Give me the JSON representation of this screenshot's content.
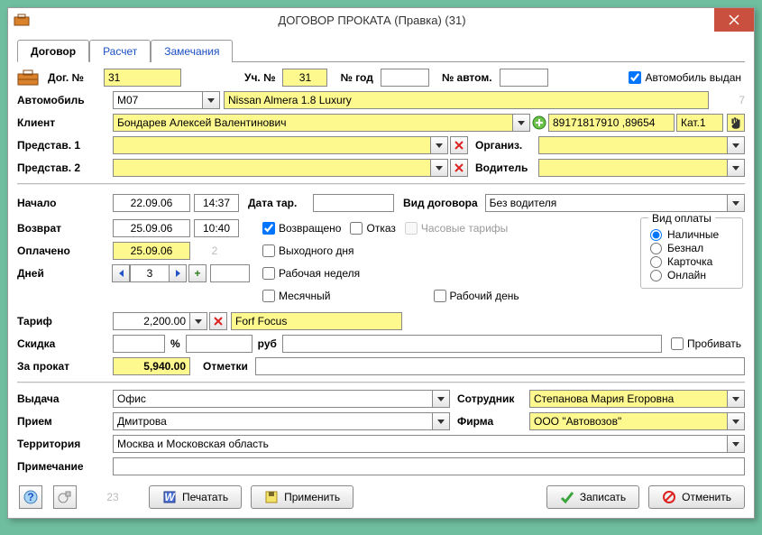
{
  "window": {
    "title": "ДОГОВОР ПРОКАТА (Правка)  (31)"
  },
  "tabs": {
    "contract": "Договор",
    "calc": "Расчет",
    "notes": "Замечания"
  },
  "hdr": {
    "dog_no_label": "Дог. №",
    "dog_no": "31",
    "uch_no_label": "Уч. №",
    "uch_no": "31",
    "year_label": "№ год",
    "year": "",
    "auto_no_label": "№ автом.",
    "auto_no": "",
    "car_given_label": "Автомобиль выдан"
  },
  "car": {
    "label": "Автомобиль",
    "code": "M07",
    "name": "Nissan Almera 1.8 Luxury",
    "extra": "7"
  },
  "client": {
    "label": "Клиент",
    "name": "Бондарев Алексей Валентинович",
    "phone": "89171817910 ,89654",
    "cat": "Кат.1"
  },
  "rep1": {
    "label": "Представ. 1",
    "org_label": "Организ."
  },
  "rep2": {
    "label": "Представ. 2",
    "drv_label": "Водитель"
  },
  "dates": {
    "start_label": "Начало",
    "start_date": "22.09.06",
    "start_time": "14:37",
    "ret_label": "Возврат",
    "ret_date": "25.09.06",
    "ret_time": "10:40",
    "paid_label": "Оплачено",
    "paid_date": "25.09.06",
    "paid_num": "2",
    "days_label": "Дней",
    "days": "3",
    "tariff_date_label": "Дата тар.",
    "contract_type_label": "Вид договора",
    "contract_type": "Без водителя"
  },
  "flags": {
    "returned": "Возвращено",
    "refusal": "Отказ",
    "hourly": "Часовые тарифы",
    "weekend": "Выходного дня",
    "workweek": "Рабочая неделя",
    "monthly": "Месячный",
    "workday": "Рабочий день"
  },
  "pay": {
    "group": "Вид оплаты",
    "cash": "Наличные",
    "bank": "Безнал",
    "card": "Карточка",
    "online": "Онлайн"
  },
  "price": {
    "tariff_label": "Тариф",
    "tariff": "2,200.00",
    "tariff_name": "Forf Focus",
    "discount_label": "Скидка",
    "pct": "%",
    "rub": "руб",
    "punch": "Пробивать",
    "rental_label": "За прокат",
    "rental": "5,940.00",
    "marks_label": "Отметки"
  },
  "loc": {
    "issue_label": "Выдача",
    "issue": "Офис",
    "emp_label": "Сотрудник",
    "emp": "Степанова Мария Егоровна",
    "recv_label": "Прием",
    "recv": "Дмитрова",
    "firm_label": "Фирма",
    "firm": "ООО \"Автовозов\"",
    "terr_label": "Территория",
    "terr": "Москва и Московская область",
    "note_label": "Примечание"
  },
  "footer": {
    "num": "23",
    "print": "Печатать",
    "apply": "Применить",
    "save": "Записать",
    "cancel": "Отменить"
  }
}
